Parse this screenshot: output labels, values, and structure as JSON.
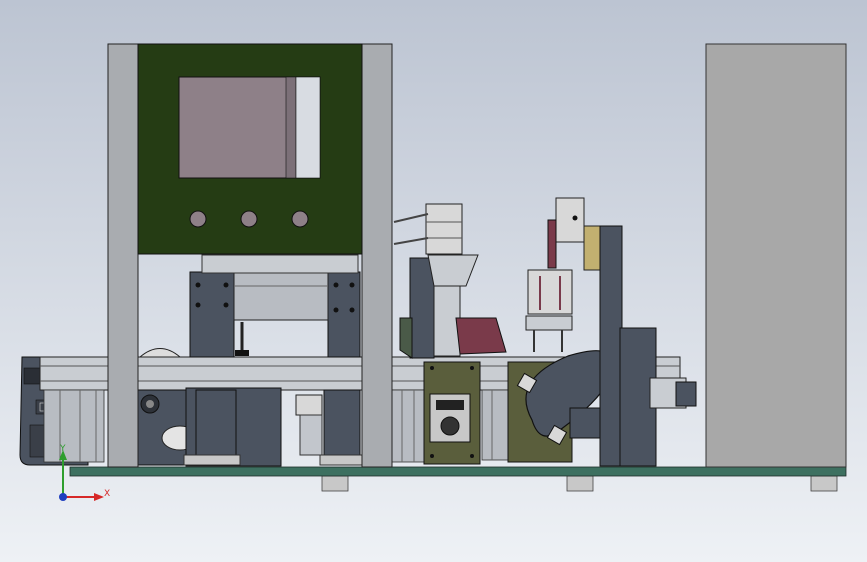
{
  "viewport": {
    "background_top": "#bcc4d2",
    "background_bottom": "#eef1f5"
  },
  "axis_triad": {
    "y_label": "Y",
    "x_label": "X",
    "y_color": "#2e9e2e",
    "x_color": "#d62828",
    "z_color": "#1f3fbf"
  },
  "colors": {
    "frame_post": "#a9acb0",
    "control_panel": "#253c14",
    "screen": "#8e8088",
    "base_plate": "#3d7060",
    "cabinet": "#a8a8a8",
    "motor_body": "#4b5360",
    "gear_box": "#5a5e3c",
    "accent_red": "#7a3a4a"
  },
  "components": [
    {
      "name": "left-frame-post",
      "label": ""
    },
    {
      "name": "right-frame-post",
      "label": ""
    },
    {
      "name": "control-panel",
      "label": ""
    },
    {
      "name": "touch-screen",
      "label": ""
    },
    {
      "name": "panel-knob-1",
      "label": ""
    },
    {
      "name": "panel-knob-2",
      "label": ""
    },
    {
      "name": "panel-knob-3",
      "label": ""
    },
    {
      "name": "conveyor-rail",
      "label": ""
    },
    {
      "name": "base-plate",
      "label": ""
    },
    {
      "name": "side-cabinet",
      "label": ""
    },
    {
      "name": "leveling-foot-1",
      "label": ""
    },
    {
      "name": "leveling-foot-2",
      "label": ""
    },
    {
      "name": "leveling-foot-3",
      "label": ""
    }
  ]
}
